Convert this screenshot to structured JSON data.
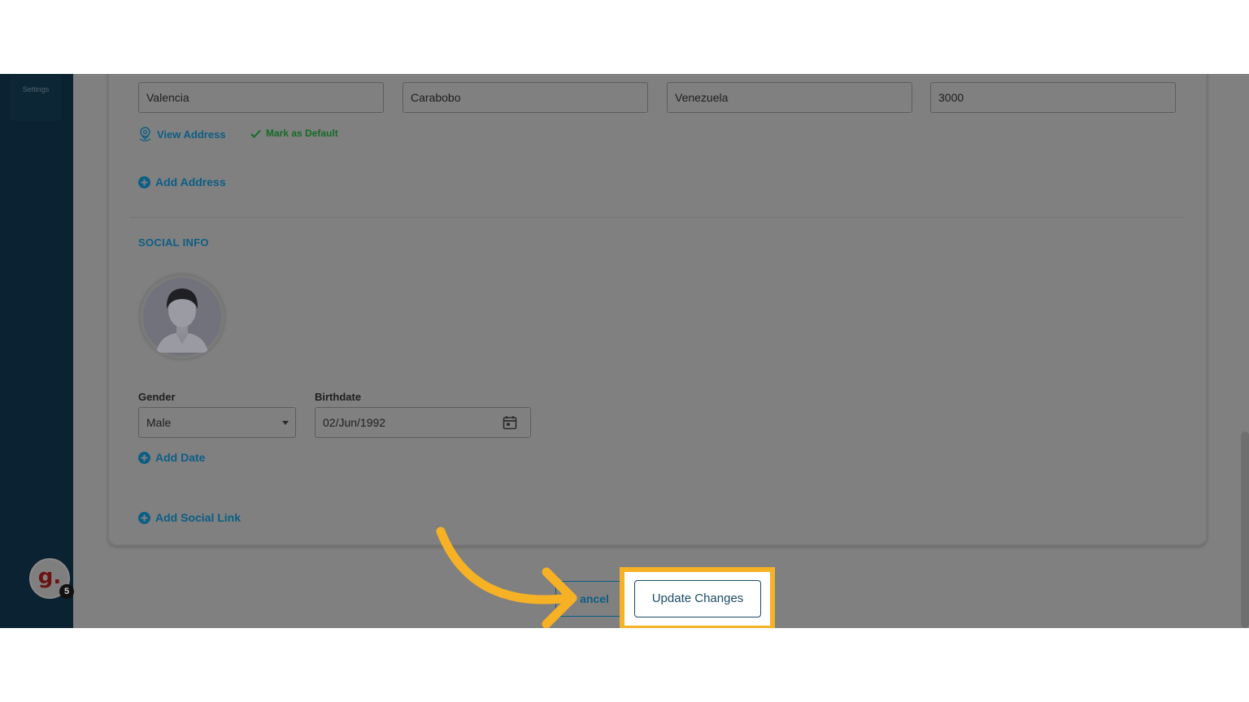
{
  "sidebar": {
    "settings_label": "Settings",
    "brand_letter": "g.",
    "notification_count": "5"
  },
  "address": {
    "fields": [
      {
        "value": "Valencia"
      },
      {
        "value": "Carabobo"
      },
      {
        "value": "Venezuela"
      },
      {
        "value": "3000"
      }
    ],
    "view_address_label": "View Address",
    "mark_default_label": "Mark as Default",
    "add_address_label": "Add Address"
  },
  "social": {
    "title": "SOCIAL INFO",
    "gender_label": "Gender",
    "gender_value": "Male",
    "birthdate_label": "Birthdate",
    "birthdate_value": "02/Jun/1992",
    "add_date_label": "Add Date",
    "add_social_link_label": "Add Social Link"
  },
  "actions": {
    "cancel_label": "ancel",
    "update_label": "Update Changes"
  },
  "colors": {
    "highlight": "#f7b125",
    "link": "#0b5e85",
    "sidebar": "#0b2232"
  }
}
